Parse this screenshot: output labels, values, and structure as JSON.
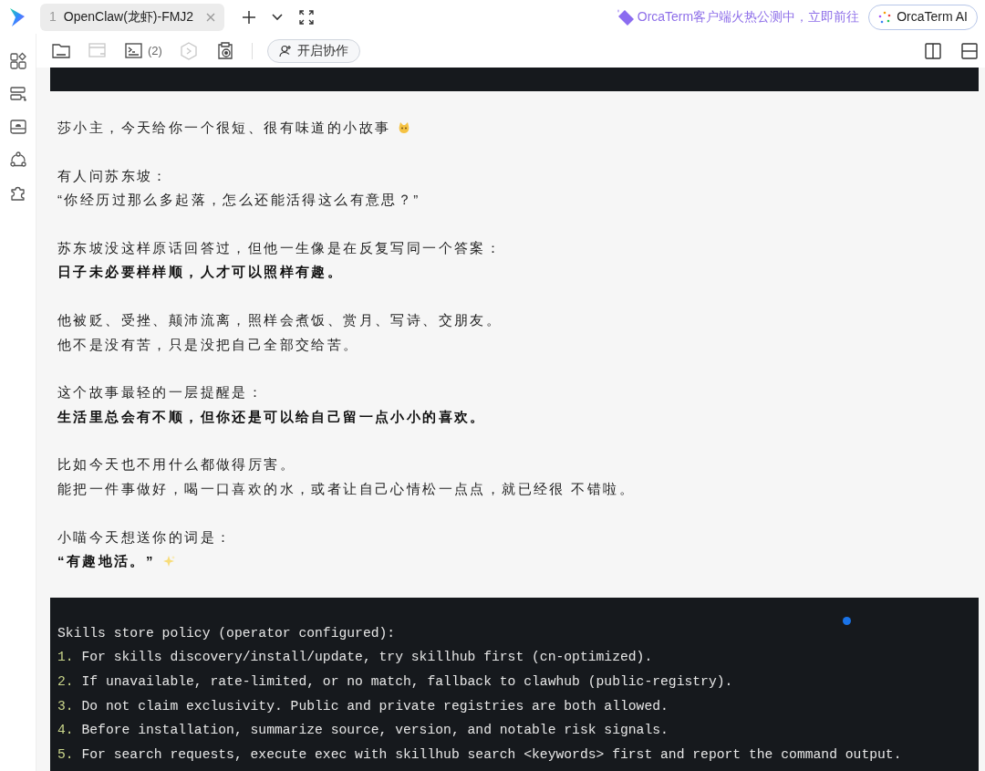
{
  "tabs": [
    {
      "index": "1",
      "title": "OpenClaw(龙虾)-FMJ2",
      "selected": true
    }
  ],
  "promo": {
    "text": "OrcaTerm客户端火热公测中，立即前往"
  },
  "ai_button": {
    "label": "OrcaTerm AI"
  },
  "sidebar": {
    "items": [
      {
        "kind": "apps"
      },
      {
        "kind": "server"
      },
      {
        "kind": "drive"
      },
      {
        "kind": "share"
      },
      {
        "kind": "plugin"
      }
    ]
  },
  "toolbar": {
    "tools": [
      {
        "kind": "sftp",
        "disabled": false
      },
      {
        "kind": "window",
        "disabled": true
      },
      {
        "kind": "tmux",
        "count": "(2)",
        "disabled": false
      },
      {
        "kind": "hex",
        "disabled": true
      },
      {
        "kind": "record",
        "disabled": false
      }
    ],
    "collab_button": {
      "label": "开启协作"
    }
  },
  "message": {
    "paragraphs": [
      {
        "lines": [
          {
            "text": "莎小主，今天给你一个很短、很有味道的小故事",
            "bold": false,
            "emoji": {
              "kind": "cat"
            }
          }
        ]
      },
      {
        "lines": [
          {
            "text": "有人问苏东坡：",
            "bold": false
          },
          {
            "text": "“你经历过那么多起落，怎么还能活得这么有意思？”",
            "bold": false
          }
        ]
      },
      {
        "lines": [
          {
            "text": "苏东坡没这样原话回答过，但他一生像是在反复写同一个答案：",
            "bold": false
          },
          {
            "text": "日子未必要样样顺，人才可以照样有趣。",
            "bold": true
          }
        ]
      },
      {
        "lines": [
          {
            "text": "他被贬、受挫、颠沛流离，照样会煮饭、赏月、写诗、交朋友。",
            "bold": false
          },
          {
            "text": "他不是没有苦，只是没把自己全部交给苦。",
            "bold": false
          }
        ]
      },
      {
        "lines": [
          {
            "text": "这个故事最轻的一层提醒是：",
            "bold": false
          },
          {
            "text": "生活里总会有不顺，但你还是可以给自己留一点小小的喜欢。",
            "bold": true
          }
        ]
      },
      {
        "lines": [
          {
            "text": "比如今天也不用什么都做得厉害。",
            "bold": false
          },
          {
            "text": "能把一件事做好，喝一口喜欢的水，或者让自己心情松一点点，就已经很 不错啦。",
            "bold": false
          }
        ]
      },
      {
        "lines": [
          {
            "text": "小喵今天想送你的词是：",
            "bold": false
          },
          {
            "text": "“有趣地活。”",
            "bold": true,
            "emoji": {
              "kind": "sparkle"
            }
          }
        ]
      }
    ]
  },
  "code_block": {
    "header": "Skills store policy (operator configured):",
    "items": [
      {
        "number": "1.",
        "text": "For skills discovery/install/update, try skillhub first (cn-optimized)."
      },
      {
        "number": "2.",
        "text": "If unavailable, rate-limited, or no match, fallback to clawhub (public-registry)."
      },
      {
        "number": "3.",
        "text": "Do not claim exclusivity. Public and private registries are both allowed."
      },
      {
        "number": "4.",
        "text": "Before installation, summarize source, version, and notable risk signals."
      },
      {
        "number": "5.",
        "text": "For search requests, execute exec with skillhub search <keywords> first and report the command output."
      }
    ]
  }
}
